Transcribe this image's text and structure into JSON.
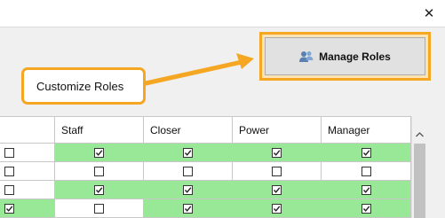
{
  "window": {
    "close_glyph": "✕"
  },
  "toolbar": {
    "manage_roles_label": "Manage Roles",
    "manage_roles_icon": "users-icon"
  },
  "callout": {
    "text": "Customize Roles",
    "accent_color": "#f5a623"
  },
  "grid": {
    "columns": [
      "",
      "Staff",
      "Closer",
      "Power",
      "Manager"
    ],
    "rows": [
      {
        "select": false,
        "cells": [
          true,
          true,
          true,
          true
        ]
      },
      {
        "select": false,
        "cells": [
          false,
          false,
          false,
          false
        ]
      },
      {
        "select": false,
        "cells": [
          true,
          true,
          true,
          true
        ]
      },
      {
        "select": true,
        "cells": [
          false,
          true,
          true,
          true
        ]
      }
    ],
    "checked_color": "#98e898"
  }
}
